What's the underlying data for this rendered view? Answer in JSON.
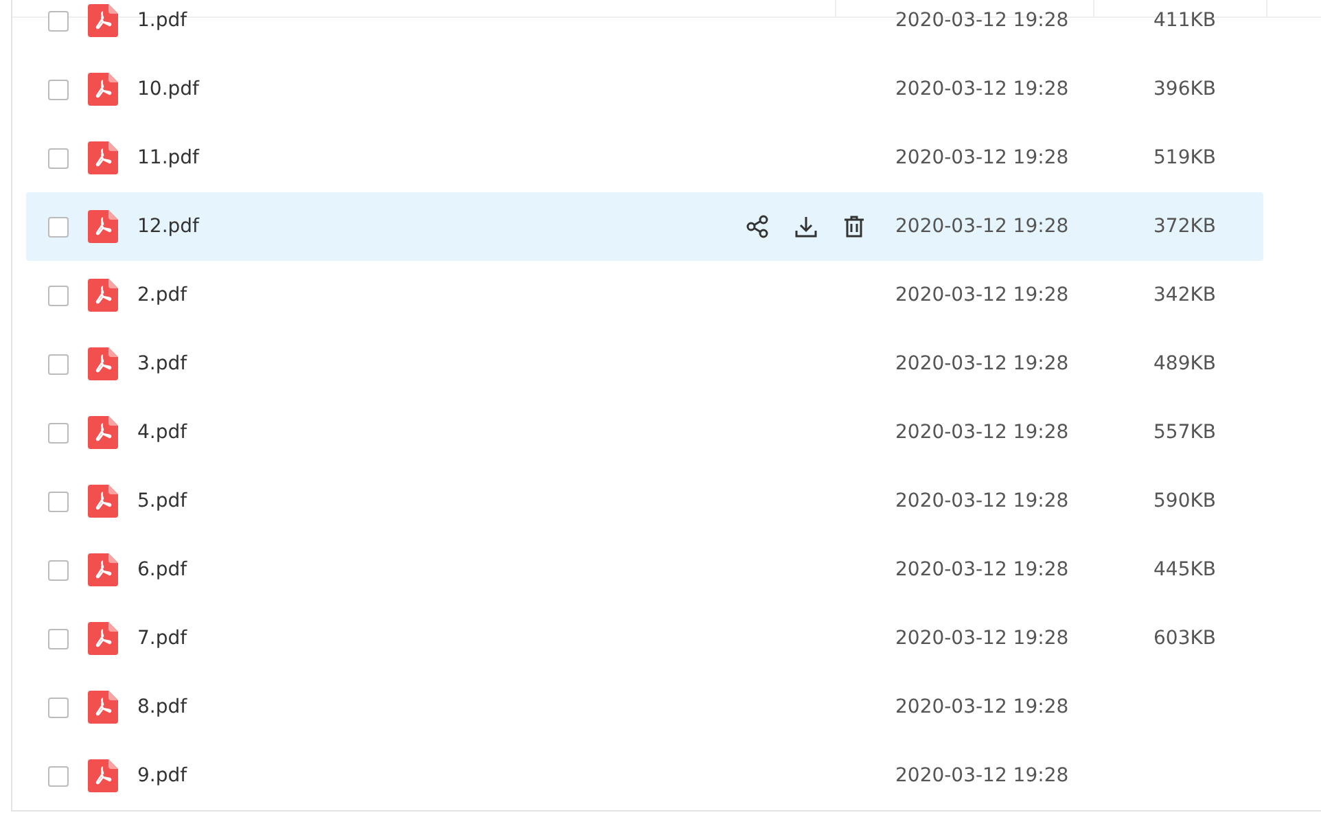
{
  "files": [
    {
      "name": "1.pdf",
      "modified": "2020-03-12 19:28",
      "size": "411KB",
      "checked": false,
      "hovered": false
    },
    {
      "name": "10.pdf",
      "modified": "2020-03-12 19:28",
      "size": "396KB",
      "checked": false,
      "hovered": false
    },
    {
      "name": "11.pdf",
      "modified": "2020-03-12 19:28",
      "size": "519KB",
      "checked": false,
      "hovered": false
    },
    {
      "name": "12.pdf",
      "modified": "2020-03-12 19:28",
      "size": "372KB",
      "checked": false,
      "hovered": true
    },
    {
      "name": "2.pdf",
      "modified": "2020-03-12 19:28",
      "size": "342KB",
      "checked": false,
      "hovered": false
    },
    {
      "name": "3.pdf",
      "modified": "2020-03-12 19:28",
      "size": "489KB",
      "checked": false,
      "hovered": false
    },
    {
      "name": "4.pdf",
      "modified": "2020-03-12 19:28",
      "size": "557KB",
      "checked": false,
      "hovered": false
    },
    {
      "name": "5.pdf",
      "modified": "2020-03-12 19:28",
      "size": "590KB",
      "checked": false,
      "hovered": false
    },
    {
      "name": "6.pdf",
      "modified": "2020-03-12 19:28",
      "size": "445KB",
      "checked": false,
      "hovered": false
    },
    {
      "name": "7.pdf",
      "modified": "2020-03-12 19:28",
      "size": "603KB",
      "checked": false,
      "hovered": false
    },
    {
      "name": "8.pdf",
      "modified": "2020-03-12 19:28",
      "checked": false,
      "hovered": false
    },
    {
      "name": "9.pdf",
      "modified": "2020-03-12 19:28",
      "checked": false,
      "hovered": false
    }
  ]
}
